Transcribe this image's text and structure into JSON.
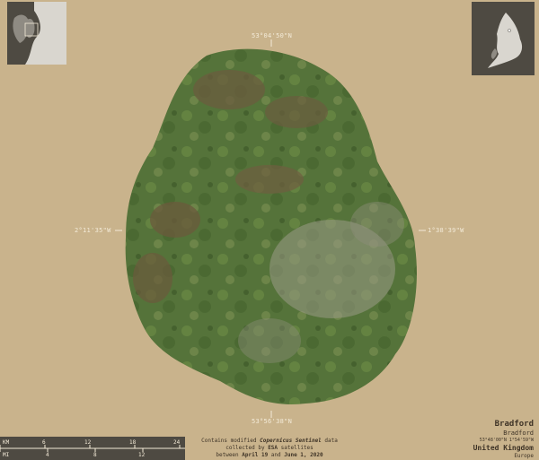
{
  "map": {
    "background_color": "#c9b38c",
    "region_color": "#5a7a3e",
    "coords": {
      "top": "53°04'50\"N",
      "bottom": "53°56'38\"N",
      "left": "2°11'35\"W",
      "right": "1°38'39\"W"
    }
  },
  "scale": {
    "km_label": "KM",
    "km_ticks": [
      "0",
      "6",
      "12",
      "18",
      "24"
    ],
    "mi_label": "MI",
    "mi_ticks": [
      "0",
      "4",
      "8",
      "12"
    ]
  },
  "credit": {
    "line1_pre": "Contains modified ",
    "line1_em": "Copernicus Sentinel",
    "line1_post": " data",
    "line2_pre": "collected by ",
    "line2_em": "ESA",
    "line2_post": " satellites",
    "line3_pre": "between ",
    "line3_d1": "April 19",
    "line3_mid": " and ",
    "line3_d2": "June 1, 2020"
  },
  "info": {
    "name": "Bradford",
    "subname": "Bradford",
    "center_coords": "53°48'00\"N 1°54'59\"W",
    "country": "United Kingdom",
    "continent": "Europe"
  }
}
